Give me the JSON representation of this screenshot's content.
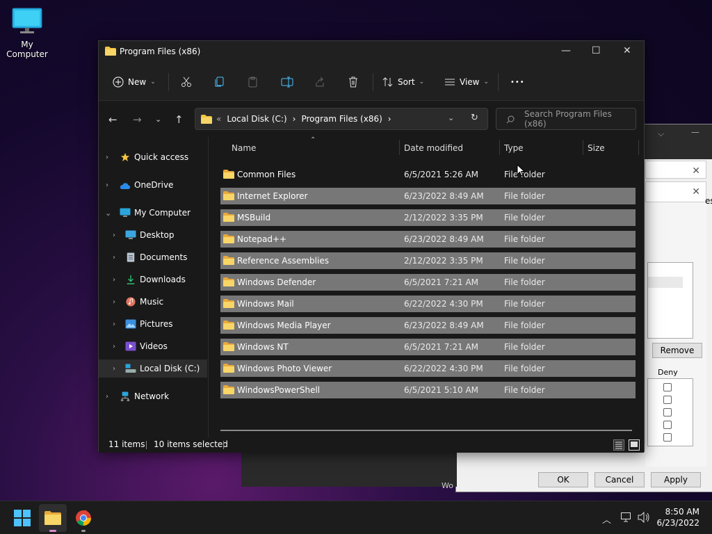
{
  "desktop": {
    "my_computer_label": "My Computer"
  },
  "background_dialog": {
    "remove_label": "Remove",
    "deny_label": "Deny",
    "ok_label": "OK",
    "cancel_label": "Cancel",
    "apply_label": "Apply",
    "partial_text": "es",
    "partial_under": "Wo"
  },
  "window": {
    "title": "Program Files (x86)",
    "minimize_glyph": "—",
    "maximize_glyph": "☐",
    "close_glyph": "✕"
  },
  "toolbar": {
    "new_label": "New",
    "sort_label": "Sort",
    "view_label": "View",
    "more_glyph": "•••"
  },
  "address": {
    "overflow": "«",
    "crumbs": [
      "Local Disk (C:)",
      "Program Files (x86)"
    ],
    "separator": "›",
    "search_placeholder": "Search Program Files (x86)"
  },
  "nav": {
    "items": [
      {
        "label": "Quick access",
        "icon": "star-icon"
      },
      {
        "label": "OneDrive",
        "icon": "cloud-icon"
      },
      {
        "label": "My Computer",
        "icon": "computer-icon",
        "expanded": true
      },
      {
        "label": "Desktop",
        "icon": "desktop-icon"
      },
      {
        "label": "Documents",
        "icon": "documents-icon"
      },
      {
        "label": "Downloads",
        "icon": "download-icon"
      },
      {
        "label": "Music",
        "icon": "music-icon"
      },
      {
        "label": "Pictures",
        "icon": "pictures-icon"
      },
      {
        "label": "Videos",
        "icon": "videos-icon"
      },
      {
        "label": "Local Disk (C:)",
        "icon": "drive-icon",
        "selected": true
      },
      {
        "label": "Network",
        "icon": "network-icon"
      }
    ]
  },
  "columns": {
    "name": "Name",
    "date": "Date modified",
    "type": "Type",
    "size": "Size"
  },
  "files": [
    {
      "name": "Common Files",
      "date": "6/5/2021 5:26 AM",
      "type": "File folder",
      "selected": false
    },
    {
      "name": "Internet Explorer",
      "date": "6/23/2022 8:49 AM",
      "type": "File folder",
      "selected": true
    },
    {
      "name": "MSBuild",
      "date": "2/12/2022 3:35 PM",
      "type": "File folder",
      "selected": true
    },
    {
      "name": "Notepad++",
      "date": "6/23/2022 8:49 AM",
      "type": "File folder",
      "selected": true
    },
    {
      "name": "Reference Assemblies",
      "date": "2/12/2022 3:35 PM",
      "type": "File folder",
      "selected": true
    },
    {
      "name": "Windows Defender",
      "date": "6/5/2021 7:21 AM",
      "type": "File folder",
      "selected": true
    },
    {
      "name": "Windows Mail",
      "date": "6/22/2022 4:30 PM",
      "type": "File folder",
      "selected": true
    },
    {
      "name": "Windows Media Player",
      "date": "6/23/2022 8:49 AM",
      "type": "File folder",
      "selected": true
    },
    {
      "name": "Windows NT",
      "date": "6/5/2021 7:21 AM",
      "type": "File folder",
      "selected": true
    },
    {
      "name": "Windows Photo Viewer",
      "date": "6/22/2022 4:30 PM",
      "type": "File folder",
      "selected": true
    },
    {
      "name": "WindowsPowerShell",
      "date": "6/5/2021 5:10 AM",
      "type": "File folder",
      "selected": true
    }
  ],
  "status": {
    "count": "11 items",
    "selected": "10 items selected"
  },
  "clock": {
    "time": "8:50 AM",
    "date": "6/23/2022"
  },
  "colors": {
    "folder": "#f4c542",
    "selected_row": "#777777",
    "accent": "#4cc2ff"
  }
}
